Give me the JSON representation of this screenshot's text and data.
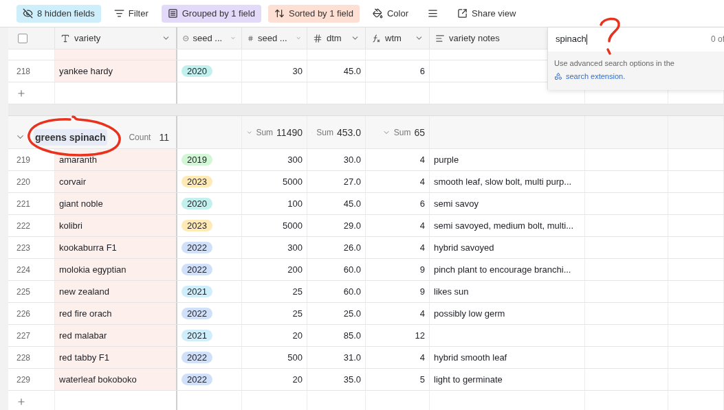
{
  "toolbar": [
    {
      "kind": "hidden",
      "label": "8 hidden fields"
    },
    {
      "kind": "filter",
      "label": "Filter"
    },
    {
      "kind": "group",
      "label": "Grouped by 1 field"
    },
    {
      "kind": "sort",
      "label": "Sorted by 1 field"
    },
    {
      "kind": "color",
      "label": "Color"
    },
    {
      "kind": "height"
    },
    {
      "kind": "share",
      "label": "Share view"
    }
  ],
  "columns": [
    {
      "kind": "text",
      "label": "variety"
    },
    {
      "kind": "select",
      "label": "seed ..."
    },
    {
      "kind": "number",
      "label": "seed ..."
    },
    {
      "kind": "number",
      "label": "dtm"
    },
    {
      "kind": "formula",
      "label": "wtm"
    },
    {
      "kind": "longtext",
      "label": "variety notes"
    }
  ],
  "select_all": {
    "checked": false
  },
  "rows_before": [
    {
      "number": "218",
      "variety": "yankee hardy",
      "year": {
        "label": "2020",
        "color": "#c2f0ec"
      },
      "seeds": "30",
      "dtm": "45.0",
      "wtm": "6"
    }
  ],
  "group": {
    "name": "greens spinach",
    "count_label": "Count",
    "count": "11",
    "sums": [
      {
        "label": "Sum",
        "value": "11490"
      },
      {
        "label": "Sum",
        "value": "453.0"
      },
      {
        "label": "Sum",
        "value": "65"
      }
    ],
    "rows": [
      {
        "number": "219",
        "variety": "amaranth",
        "year": {
          "label": "2019",
          "color": "#d1f7d4"
        },
        "seeds": "300",
        "dtm": "30.0",
        "wtm": "4",
        "notes": "purple"
      },
      {
        "number": "220",
        "variety": "corvair",
        "year": {
          "label": "2023",
          "color": "#ffeab6"
        },
        "seeds": "5000",
        "dtm": "27.0",
        "wtm": "4",
        "notes": "smooth leaf, slow bolt, multi purp..."
      },
      {
        "number": "221",
        "variety": "giant noble",
        "year": {
          "label": "2020",
          "color": "#c2f0ec"
        },
        "seeds": "100",
        "dtm": "45.0",
        "wtm": "6",
        "notes": "semi savoy"
      },
      {
        "number": "222",
        "variety": "kolibri",
        "year": {
          "label": "2023",
          "color": "#ffeab6"
        },
        "seeds": "5000",
        "dtm": "29.0",
        "wtm": "4",
        "notes": "semi savoyed, medium bolt, multi..."
      },
      {
        "number": "223",
        "variety": "kookaburra F1",
        "year": {
          "label": "2022",
          "color": "#d0e0fb"
        },
        "seeds": "300",
        "dtm": "26.0",
        "wtm": "4",
        "notes": "hybrid savoyed"
      },
      {
        "number": "224",
        "variety": "molokia egyptian",
        "year": {
          "label": "2022",
          "color": "#d0e0fb"
        },
        "seeds": "200",
        "dtm": "60.0",
        "wtm": "9",
        "notes": "pinch plant to encourage branchi..."
      },
      {
        "number": "225",
        "variety": "new zealand",
        "year": {
          "label": "2021",
          "color": "#cfeefc"
        },
        "seeds": "25",
        "dtm": "60.0",
        "wtm": "9",
        "notes": "likes sun"
      },
      {
        "number": "226",
        "variety": "red fire orach",
        "year": {
          "label": "2022",
          "color": "#d0e0fb"
        },
        "seeds": "25",
        "dtm": "25.0",
        "wtm": "4",
        "notes": "possibly low germ"
      },
      {
        "number": "227",
        "variety": "red malabar",
        "year": {
          "label": "2021",
          "color": "#cfeefc"
        },
        "seeds": "20",
        "dtm": "85.0",
        "wtm": "12"
      },
      {
        "number": "228",
        "variety": "red tabby F1",
        "year": {
          "label": "2022",
          "color": "#d0e0fb"
        },
        "seeds": "500",
        "dtm": "31.0",
        "wtm": "4",
        "notes": "hybrid smooth leaf"
      },
      {
        "number": "229",
        "variety": "waterleaf bokoboko",
        "year": {
          "label": "2022",
          "color": "#d0e0fb"
        },
        "seeds": "20",
        "dtm": "35.0",
        "wtm": "5",
        "notes": "light to germinate"
      }
    ]
  },
  "search": {
    "value": "spinach",
    "results": "0 of",
    "hint": "Use advanced search options in the",
    "link": "search extension."
  },
  "annotations": [
    {
      "kind": "circle"
    },
    {
      "kind": "question"
    }
  ]
}
